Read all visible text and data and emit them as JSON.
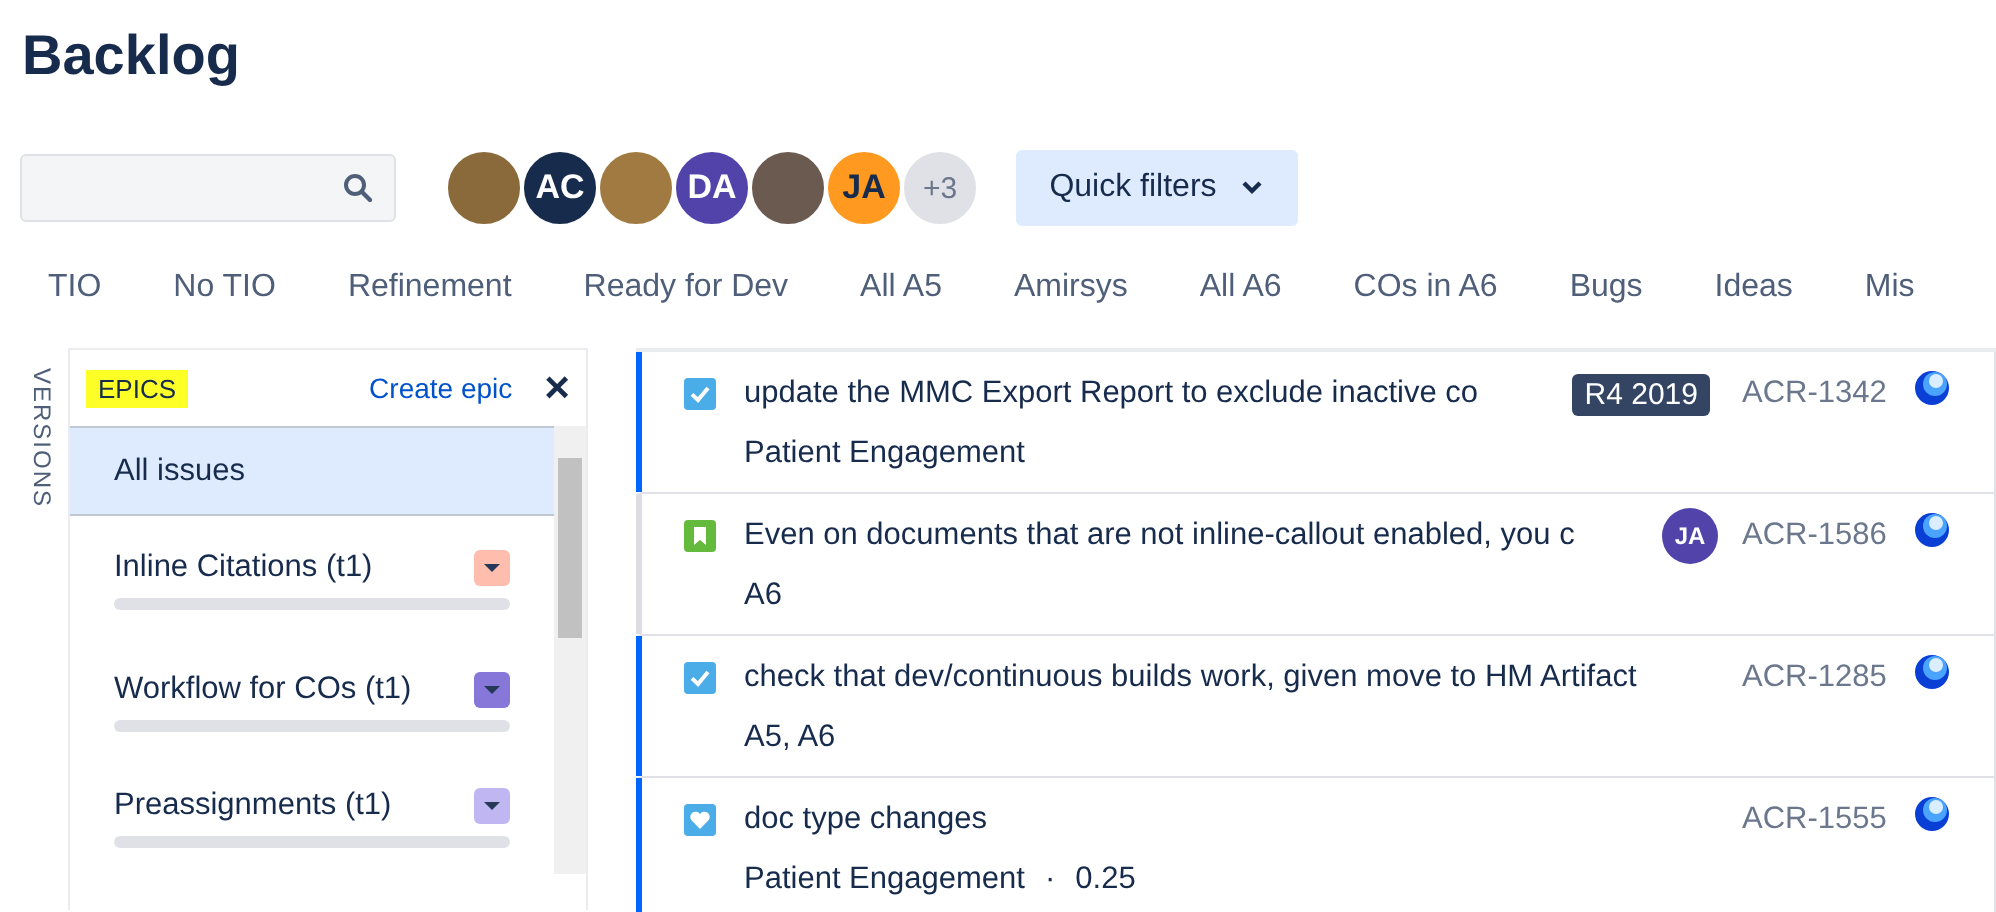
{
  "page": {
    "title": "Backlog"
  },
  "avatars": [
    {
      "kind": "image",
      "color": "#8a6a3a"
    },
    {
      "kind": "initials",
      "initials": "AC",
      "color": "#172b4d"
    },
    {
      "kind": "image",
      "color": "#a07a40"
    },
    {
      "kind": "initials",
      "initials": "DA",
      "color": "#5243aa"
    },
    {
      "kind": "image",
      "color": "#6b5a50"
    },
    {
      "kind": "initials",
      "initials": "JA",
      "color": "#ff991f"
    },
    {
      "kind": "more",
      "initials": "+3",
      "color": "#dfe1e6"
    }
  ],
  "quick_filters": {
    "label": "Quick filters"
  },
  "filters": [
    {
      "label": "TIO"
    },
    {
      "label": "No TIO"
    },
    {
      "label": "Refinement"
    },
    {
      "label": "Ready for Dev"
    },
    {
      "label": "All A5"
    },
    {
      "label": "Amirsys"
    },
    {
      "label": "All A6"
    },
    {
      "label": "COs in A6"
    },
    {
      "label": "Bugs"
    },
    {
      "label": "Ideas"
    },
    {
      "label": "Mis"
    }
  ],
  "versions_tab": {
    "label": "VERSIONS"
  },
  "epics_panel": {
    "title": "EPICS",
    "create_link": "Create epic",
    "close": "×",
    "items": [
      {
        "name": "All issues",
        "selected": true
      },
      {
        "name": "Inline Citations (t1)",
        "selected": false,
        "color": "#ffbdad",
        "level": 0
      },
      {
        "name": "Workflow for COs (t1)",
        "selected": false,
        "color": "#8777d9",
        "level": 0
      },
      {
        "name": "Preassignments (t1)",
        "selected": false,
        "color": "#c0b6f2",
        "level": 0
      }
    ]
  },
  "issues": [
    {
      "kind": "task",
      "selected": true,
      "summary": "update the MMC Export Report to exclude inactive co",
      "version": "R4 2019",
      "key": "ACR-1342",
      "epics": "Patient Engagement"
    },
    {
      "kind": "story",
      "selected": false,
      "summary": "Even on documents that are not inline-callout enabled, you c",
      "assignee": {
        "initials": "JA",
        "color": "#5243aa"
      },
      "key": "ACR-1586",
      "epics": "A6"
    },
    {
      "kind": "task",
      "selected": true,
      "summary": "check that dev/continuous builds work, given move to HM Artifact",
      "key": "ACR-1285",
      "epics": "A5, A6"
    },
    {
      "kind": "feedback",
      "selected": true,
      "summary": "doc type changes",
      "key": "ACR-1555",
      "epics": "Patient Engagement",
      "separator": "·",
      "estimate": "0.25"
    }
  ]
}
